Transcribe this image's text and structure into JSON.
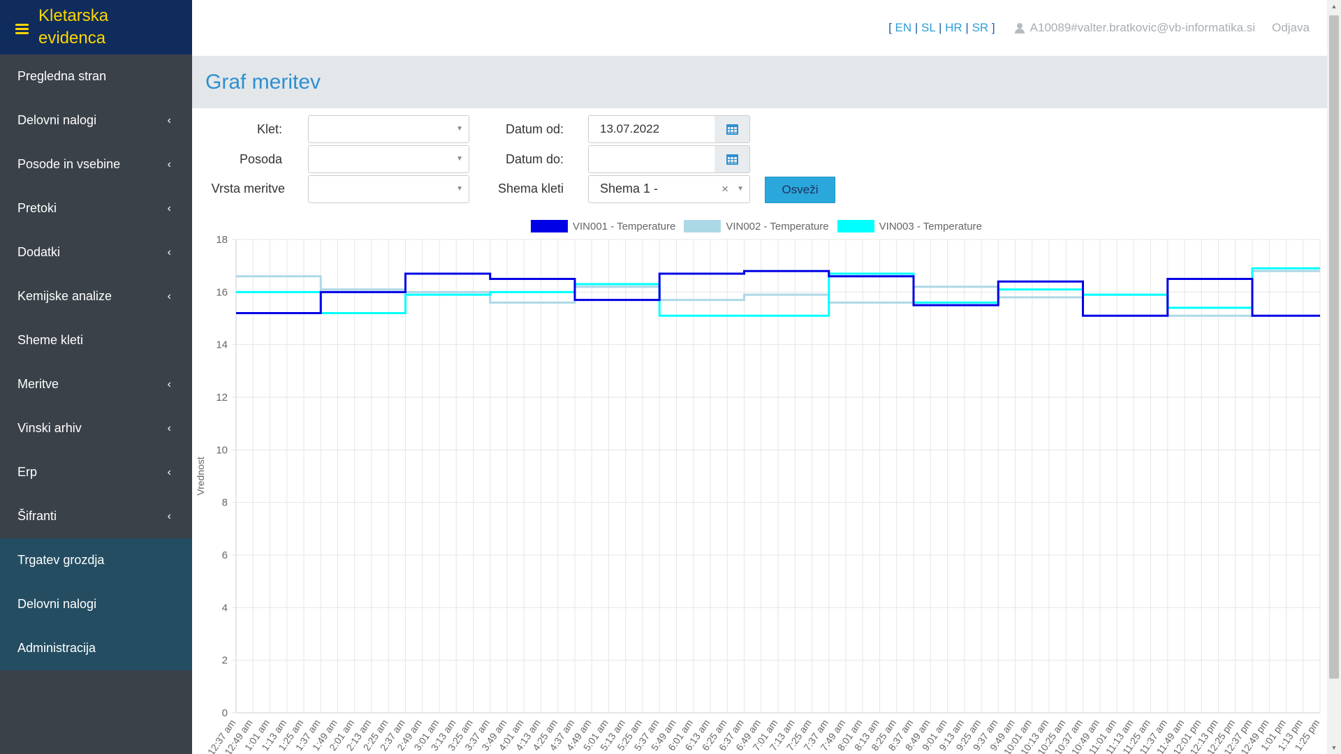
{
  "sidebar": {
    "brand": "Kletarska evidenca",
    "items": [
      {
        "label": "Pregledna stran",
        "chevron": false
      },
      {
        "label": "Delovni nalogi",
        "chevron": true
      },
      {
        "label": "Posode in vsebine",
        "chevron": true
      },
      {
        "label": "Pretoki",
        "chevron": true
      },
      {
        "label": "Dodatki",
        "chevron": true
      },
      {
        "label": "Kemijske analize",
        "chevron": true
      },
      {
        "label": "Sheme kleti",
        "chevron": false
      },
      {
        "label": "Meritve",
        "chevron": true
      },
      {
        "label": "Vinski arhiv",
        "chevron": true
      },
      {
        "label": "Erp",
        "chevron": true
      },
      {
        "label": "Šifranti",
        "chevron": true
      }
    ],
    "secondary_items": [
      {
        "label": "Trgatev grozdja"
      },
      {
        "label": "Delovni nalogi"
      },
      {
        "label": "Administracija"
      }
    ],
    "chevron_glyph": "‹"
  },
  "topbar": {
    "lang_open": "[",
    "lang_close": "]",
    "lang_sep": "|",
    "languages": [
      "EN",
      "SL",
      "HR",
      "SR"
    ],
    "user": "A10089#valter.bratkovic@vb-informatika.si",
    "logout": "Odjava"
  },
  "page": {
    "title": "Graf meritev"
  },
  "filters": {
    "klet_label": "Klet:",
    "posoda_label": "Posoda",
    "vrsta_label": "Vrsta meritve",
    "datum_od_label": "Datum od:",
    "datum_od_value": "13.07.2022",
    "datum_do_label": "Datum do:",
    "datum_do_value": "",
    "shema_label": "Shema kleti",
    "shema_value": "Shema 1 -",
    "refresh_label": "Osveži"
  },
  "colors": {
    "sidebar_bg": "#3a4149",
    "brand_bg": "#0f2c5c",
    "brand_text": "#ffd600",
    "accent": "#2d8fd0"
  },
  "chart_data": {
    "type": "line",
    "stepped": true,
    "ylabel": "Vrednost",
    "ylim": [
      0,
      18
    ],
    "yticks": [
      0,
      2,
      4,
      6,
      8,
      10,
      12,
      14,
      16,
      18
    ],
    "grid": true,
    "legend_position": "top",
    "x": [
      "12:37 am",
      "12:49 am",
      "1:01 am",
      "1:13 am",
      "1:25 am",
      "1:37 am",
      "1:49 am",
      "2:01 am",
      "2:13 am",
      "2:25 am",
      "2:37 am",
      "2:49 am",
      "3:01 am",
      "3:13 am",
      "3:25 am",
      "3:37 am",
      "3:49 am",
      "4:01 am",
      "4:13 am",
      "4:25 am",
      "4:37 am",
      "4:49 am",
      "5:01 am",
      "5:13 am",
      "5:25 am",
      "5:37 am",
      "5:49 am",
      "6:01 am",
      "6:13 am",
      "6:25 am",
      "6:37 am",
      "6:49 am",
      "7:01 am",
      "7:13 am",
      "7:25 am",
      "7:37 am",
      "7:49 am",
      "8:01 am",
      "8:13 am",
      "8:25 am",
      "8:37 am",
      "8:49 am",
      "9:01 am",
      "9:13 am",
      "9:25 am",
      "9:37 am",
      "9:49 am",
      "10:01 am",
      "10:13 am",
      "10:25 am",
      "10:37 am",
      "10:49 am",
      "11:01 am",
      "11:13 am",
      "11:25 am",
      "11:37 am",
      "11:49 am",
      "12:01 pm",
      "12:13 pm",
      "12:25 pm",
      "12:37 pm",
      "12:49 pm",
      "1:01 pm",
      "1:13 pm",
      "1:25 pm"
    ],
    "series": [
      {
        "name": "VIN001 - Temperature",
        "color": "#0000e6",
        "width": 3,
        "values": [
          15.2,
          15.2,
          15.2,
          15.2,
          15.2,
          16.0,
          16.0,
          16.0,
          16.0,
          16.0,
          16.7,
          16.7,
          16.7,
          16.7,
          16.7,
          16.5,
          16.5,
          16.5,
          16.5,
          16.5,
          15.7,
          15.7,
          15.7,
          15.7,
          15.7,
          16.7,
          16.7,
          16.7,
          16.7,
          16.7,
          16.8,
          16.8,
          16.8,
          16.8,
          16.8,
          16.6,
          16.6,
          16.6,
          16.6,
          16.6,
          15.5,
          15.5,
          15.5,
          15.5,
          15.5,
          16.4,
          16.4,
          16.4,
          16.4,
          16.4,
          15.1,
          15.1,
          15.1,
          15.1,
          15.1,
          16.5,
          16.5,
          16.5,
          16.5,
          16.5,
          15.1,
          15.1,
          15.1,
          15.1,
          15.1
        ]
      },
      {
        "name": "VIN002 - Temperature",
        "color": "#add8e6",
        "width": 3,
        "values": [
          16.6,
          16.6,
          16.6,
          16.6,
          16.6,
          16.1,
          16.1,
          16.1,
          16.1,
          16.1,
          16.0,
          16.0,
          16.0,
          16.0,
          16.0,
          15.6,
          15.6,
          15.6,
          15.6,
          15.6,
          16.2,
          16.2,
          16.2,
          16.2,
          16.2,
          15.7,
          15.7,
          15.7,
          15.7,
          15.7,
          15.9,
          15.9,
          15.9,
          15.9,
          15.9,
          15.6,
          15.6,
          15.6,
          15.6,
          15.6,
          16.2,
          16.2,
          16.2,
          16.2,
          16.2,
          15.8,
          15.8,
          15.8,
          15.8,
          15.8,
          15.9,
          15.9,
          15.9,
          15.9,
          15.9,
          15.1,
          15.1,
          15.1,
          15.1,
          15.1,
          16.8,
          16.8,
          16.8,
          16.8,
          16.8
        ]
      },
      {
        "name": "VIN003 - Temperature",
        "color": "#00ffff",
        "width": 3,
        "values": [
          16.0,
          16.0,
          16.0,
          16.0,
          16.0,
          15.2,
          15.2,
          15.2,
          15.2,
          15.2,
          15.9,
          15.9,
          15.9,
          15.9,
          15.9,
          16.0,
          16.0,
          16.0,
          16.0,
          16.0,
          16.3,
          16.3,
          16.3,
          16.3,
          16.3,
          15.1,
          15.1,
          15.1,
          15.1,
          15.1,
          15.1,
          15.1,
          15.1,
          15.1,
          15.1,
          16.7,
          16.7,
          16.7,
          16.7,
          16.7,
          15.6,
          15.6,
          15.6,
          15.6,
          15.6,
          16.1,
          16.1,
          16.1,
          16.1,
          16.1,
          15.9,
          15.9,
          15.9,
          15.9,
          15.9,
          15.4,
          15.4,
          15.4,
          15.4,
          15.4,
          16.9,
          16.9,
          16.9,
          16.9,
          16.9
        ]
      }
    ]
  }
}
